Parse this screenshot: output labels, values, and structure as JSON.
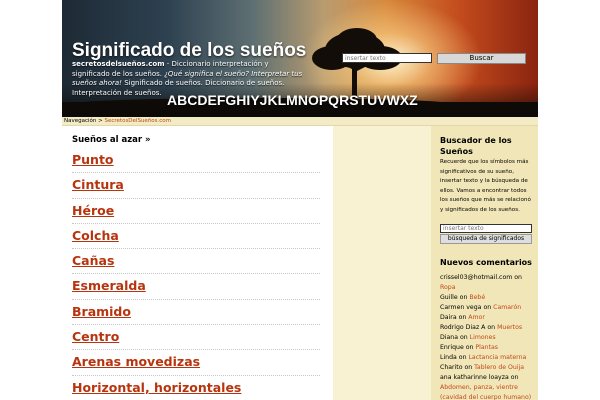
{
  "header": {
    "site_title": "Significado de los sueños",
    "site_domain": "secretosdelsueños.com",
    "desc_part1": " - Diccionario interpretación y significado de los sueños. ",
    "desc_italic": "¿Qué significa el sueño? Interpretar tus sueños ahora!",
    "desc_part2": " Significado de sueños. Diccionario de sueños. Interpretación de sueños.",
    "search_placeholder": "insertar texto",
    "search_button": "Buscar",
    "alphabet": [
      "A",
      "B",
      "C",
      "D",
      "E",
      "F",
      "G",
      "H",
      "I",
      "Y",
      "J",
      "K",
      "L",
      "M",
      "N",
      "O",
      "P",
      "Q",
      "R",
      "S",
      "T",
      "U",
      "V",
      "W",
      "X",
      "Z"
    ]
  },
  "breadcrumb": {
    "label": "Navegación",
    "separator": ">",
    "link": "SecretosDelSueños.com"
  },
  "main": {
    "random_heading": "Sueños al azar »",
    "items": [
      "Punto",
      "Cintura",
      "Héroe",
      "Colcha",
      "Cañas",
      "Esmeralda",
      "Bramido",
      "Centro",
      "Arenas movedizas",
      "Horizontal, horizontales"
    ]
  },
  "sidebar": {
    "search_title": "Buscador de los Sueños",
    "search_text": "Recuerde que los símbolos más significativos de su sueño, insertar texto y la búsqueda de ellos. Vamos a encontrar todos los sueños que más se relacionó y significados de los sueños.",
    "search_placeholder": "insertar texto",
    "search_button": "búsqueda de significados",
    "comments_title": "Nuevos comentarios",
    "comments_connector": "on",
    "comments": [
      {
        "author": "crissel03@hotmail.com",
        "post": "Ropa"
      },
      {
        "author": "Guille",
        "post": "Bebé"
      },
      {
        "author": "Carmen vega",
        "post": "Camarón"
      },
      {
        "author": "Daira",
        "post": "Amor"
      },
      {
        "author": "Rodrigo Diaz A",
        "post": "Muertos"
      },
      {
        "author": "Diana",
        "post": "Limones"
      },
      {
        "author": "Enrique",
        "post": "Plantas"
      },
      {
        "author": "Linda",
        "post": "Lactancia materna"
      },
      {
        "author": "Charito",
        "post": "Tablero de Ouija"
      },
      {
        "author": "ana katharinne loayza",
        "post": "Abdomen, panza, vientre (cavidad del cuerpo humano)"
      }
    ]
  },
  "colors": {
    "link": "#b8340e",
    "breadcrumb_bg": "#f3ebc6",
    "sidebar_bg": "#f1e6b7",
    "middle_bg": "#f8f1d2"
  }
}
